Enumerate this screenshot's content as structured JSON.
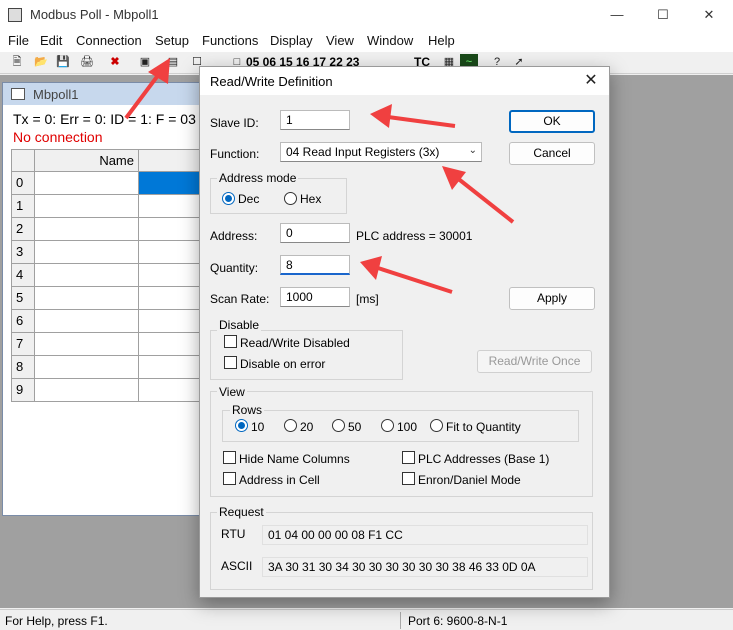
{
  "window": {
    "title": "Modbus Poll - Mbpoll1"
  },
  "menu": [
    "File",
    "Edit",
    "Connection",
    "Setup",
    "Functions",
    "Display",
    "View",
    "Window",
    "Help"
  ],
  "toolbar": {
    "codes": "05 06 15 16 17 22 23",
    "tc": "TC"
  },
  "child": {
    "title": "Mbpoll1",
    "status": "Tx = 0: Err = 0: ID = 1: F = 03",
    "connection": "No connection",
    "name_header": "Name",
    "rows": [
      "0",
      "1",
      "2",
      "3",
      "4",
      "5",
      "6",
      "7",
      "8",
      "9"
    ]
  },
  "statusbar": {
    "help": "For Help, press F1.",
    "port": "Port 6: 9600-8-N-1"
  },
  "dialog": {
    "title": "Read/Write Definition",
    "slave_id_label": "Slave ID:",
    "slave_id": "1",
    "function_label": "Function:",
    "function": "04 Read Input Registers (3x)",
    "address_mode_label": "Address mode",
    "dec": "Dec",
    "hex": "Hex",
    "address_label": "Address:",
    "address": "0",
    "plc_address": "PLC address = 30001",
    "quantity_label": "Quantity:",
    "quantity": "8",
    "scan_rate_label": "Scan Rate:",
    "scan_rate": "1000",
    "scan_unit": "[ms]",
    "ok": "OK",
    "cancel": "Cancel",
    "apply": "Apply",
    "disable_label": "Disable",
    "rw_disabled": "Read/Write Disabled",
    "disable_on_error": "Disable on error",
    "rw_once": "Read/Write Once",
    "view_label": "View",
    "rows_label": "Rows",
    "rows_options": [
      "10",
      "20",
      "50",
      "100",
      "Fit to Quantity"
    ],
    "hide_name_columns": "Hide Name Columns",
    "plc_addresses": "PLC Addresses (Base 1)",
    "address_in_cell": "Address in Cell",
    "enron_mode": "Enron/Daniel Mode",
    "request_label": "Request",
    "rtu_label": "RTU",
    "rtu": "01 04 00 00 00 08 F1 CC",
    "ascii_label": "ASCII",
    "ascii": "3A 30 31 30 34 30 30 30 30 30 30 38 46 33 0D 0A"
  },
  "colors": {
    "accent": "#0067c0",
    "arrow": "#f04040",
    "error_text": "#e00000"
  }
}
